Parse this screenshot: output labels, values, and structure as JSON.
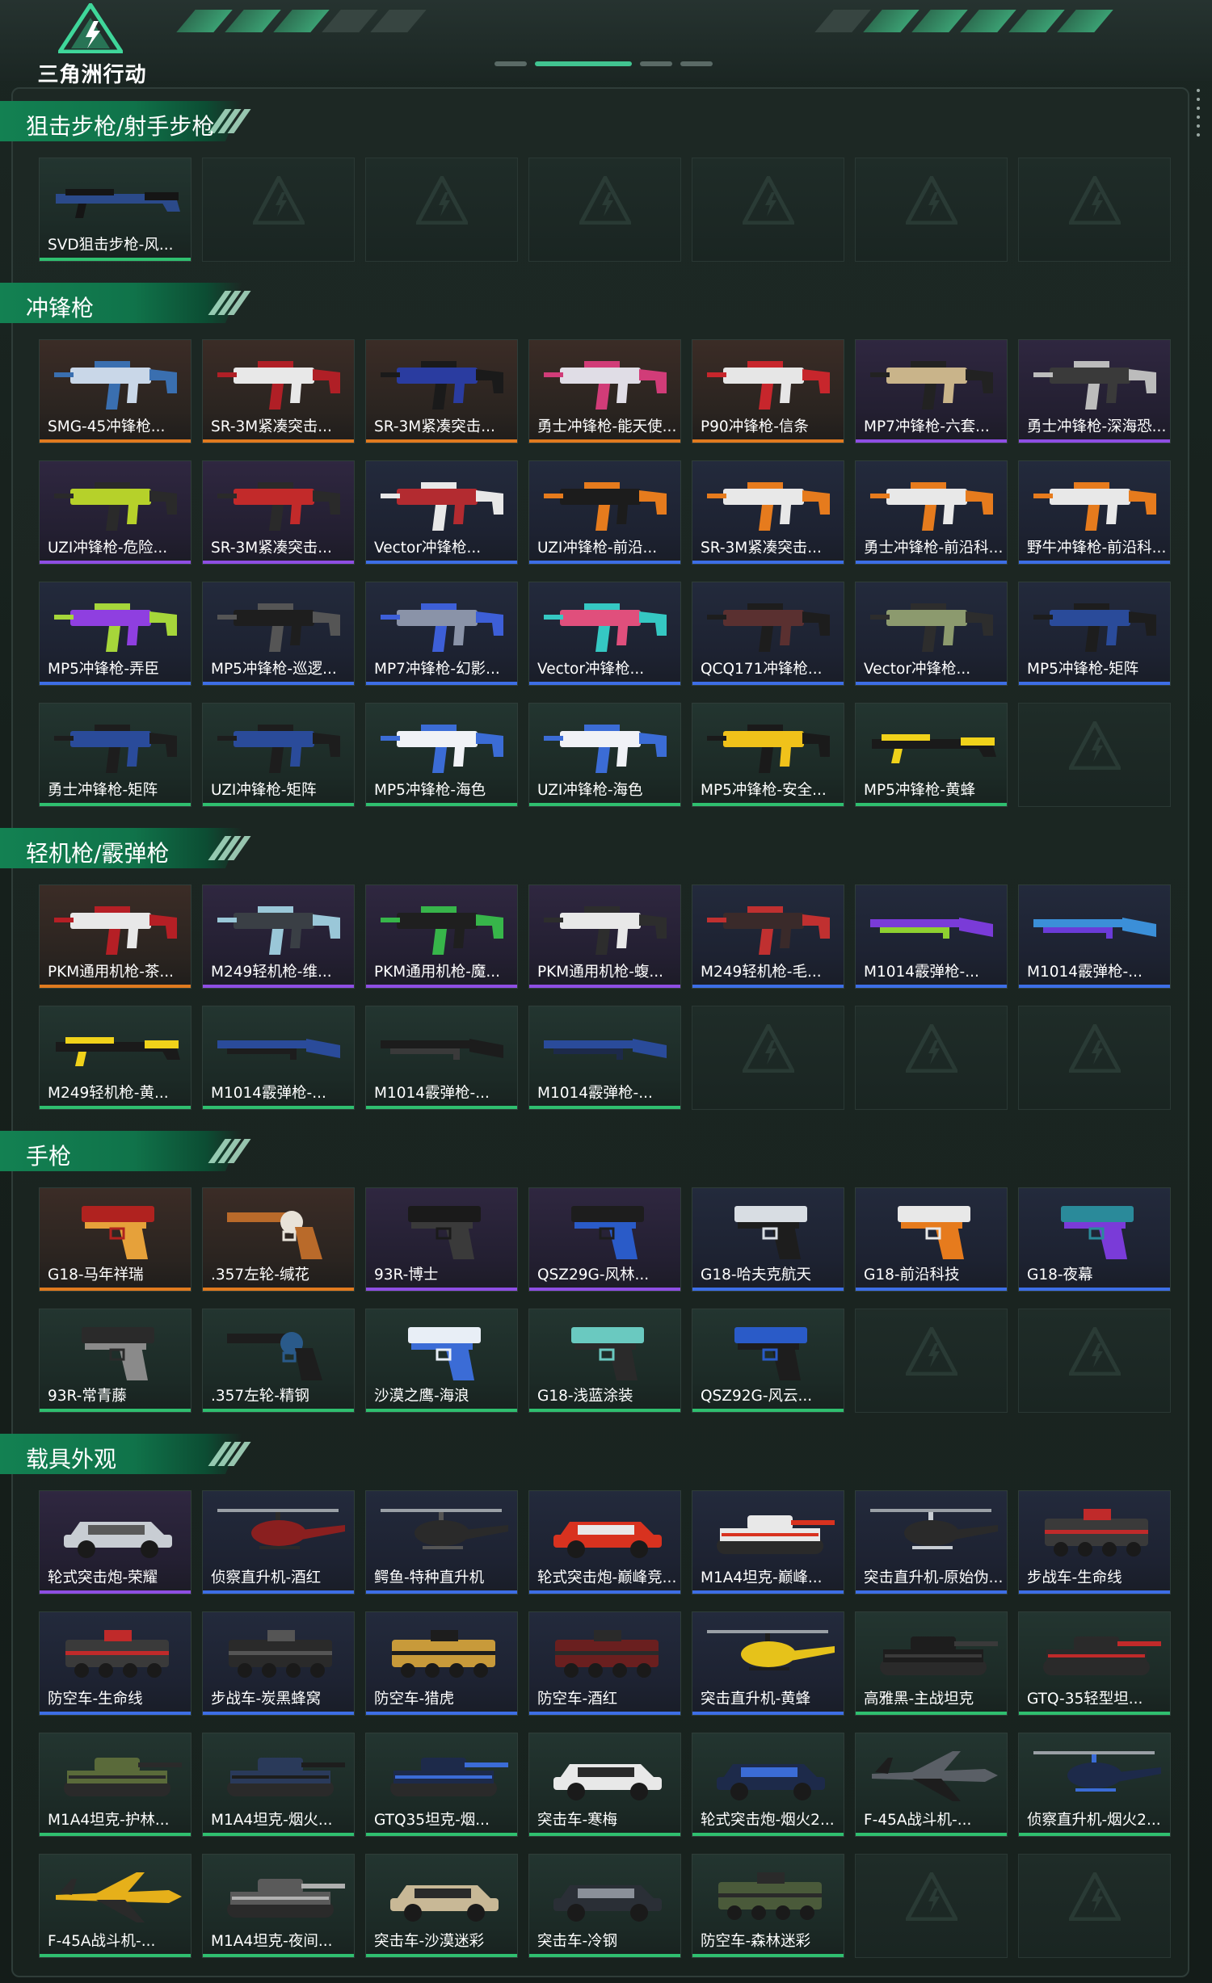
{
  "header": {
    "logo_text": "三角洲行动",
    "accent_color": "#3fb37f"
  },
  "sections": [
    {
      "title": "狙击步枪/射手步枪",
      "items": [
        {
          "name": "SVD狙击步枪-风...",
          "tier": "green",
          "type": "rifle",
          "c1": "#2b4a8a",
          "c2": "#151515"
        }
      ]
    },
    {
      "title": "冲锋枪",
      "items": [
        {
          "name": "SMG-45冲锋枪...",
          "tier": "gold",
          "type": "smg",
          "c1": "#c9d7e8",
          "c2": "#3a6fb0"
        },
        {
          "name": "SR-3M紧凑突击...",
          "tier": "gold",
          "type": "smg",
          "c1": "#e8e8e8",
          "c2": "#b01f26"
        },
        {
          "name": "SR-3M紧凑突击...",
          "tier": "gold",
          "type": "smg",
          "c1": "#2a3ca0",
          "c2": "#1a1a1a"
        },
        {
          "name": "勇士冲锋枪-能天使...",
          "tier": "gold",
          "type": "smg",
          "c1": "#e0dde6",
          "c2": "#d13c78"
        },
        {
          "name": "P90冲锋枪-信条",
          "tier": "gold",
          "type": "smg",
          "c1": "#e6e6e6",
          "c2": "#c7262c"
        },
        {
          "name": "MP7冲锋枪-六套...",
          "tier": "purple",
          "type": "smg",
          "c1": "#c9b48a",
          "c2": "#222222"
        },
        {
          "name": "勇士冲锋枪-深海恐...",
          "tier": "purple",
          "type": "smg",
          "c1": "#3a3a3a",
          "c2": "#bcbcbc"
        },
        {
          "name": "UZI冲锋枪-危险...",
          "tier": "purple",
          "type": "smg",
          "c1": "#b6d12a",
          "c2": "#2a2a2a"
        },
        {
          "name": "SR-3M紧凑突击...",
          "tier": "purple",
          "type": "smg",
          "c1": "#c22a2a",
          "c2": "#2a2a2a"
        },
        {
          "name": "Vector冲锋枪...",
          "tier": "blue",
          "type": "smg",
          "c1": "#b32b30",
          "c2": "#e8e8e8"
        },
        {
          "name": "UZI冲锋枪-前沿...",
          "tier": "blue",
          "type": "smg",
          "c1": "#1c1c1c",
          "c2": "#e67b1d"
        },
        {
          "name": "SR-3M紧凑突击...",
          "tier": "blue",
          "type": "smg",
          "c1": "#e8e8e8",
          "c2": "#e67b1d"
        },
        {
          "name": "勇士冲锋枪-前沿科...",
          "tier": "blue",
          "type": "smg",
          "c1": "#e8e8e8",
          "c2": "#e67b1d"
        },
        {
          "name": "野牛冲锋枪-前沿科...",
          "tier": "blue",
          "type": "smg",
          "c1": "#e8e8e8",
          "c2": "#e67b1d"
        },
        {
          "name": "MP5冲锋枪-弄臣",
          "tier": "blue",
          "type": "smg",
          "c1": "#8f3fe0",
          "c2": "#a6d63a"
        },
        {
          "name": "MP5冲锋枪-巡逻...",
          "tier": "blue",
          "type": "smg",
          "c1": "#1e1e1e",
          "c2": "#555555"
        },
        {
          "name": "MP7冲锋枪-幻影...",
          "tier": "blue",
          "type": "smg",
          "c1": "#8a93a8",
          "c2": "#3d5fd8"
        },
        {
          "name": "Vector冲锋枪...",
          "tier": "blue",
          "type": "smg",
          "c1": "#e04f7c",
          "c2": "#35c8c3"
        },
        {
          "name": "QCQ171冲锋枪...",
          "tier": "blue",
          "type": "smg",
          "c1": "#5a3030",
          "c2": "#1d1d1d"
        },
        {
          "name": "Vector冲锋枪...",
          "tier": "blue",
          "type": "smg",
          "c1": "#8c9a6e",
          "c2": "#2d2d2d"
        },
        {
          "name": "MP5冲锋枪-矩阵",
          "tier": "blue",
          "type": "smg",
          "c1": "#2a4b9a",
          "c2": "#1d1d1d"
        },
        {
          "name": "勇士冲锋枪-矩阵",
          "tier": "green",
          "type": "smg",
          "c1": "#2a4b9a",
          "c2": "#1d1d1d"
        },
        {
          "name": "UZI冲锋枪-矩阵",
          "tier": "green",
          "type": "smg",
          "c1": "#2a4b9a",
          "c2": "#1d1d1d"
        },
        {
          "name": "MP5冲锋枪-海色",
          "tier": "green",
          "type": "smg",
          "c1": "#f0f2f6",
          "c2": "#3b6cd6"
        },
        {
          "name": "UZI冲锋枪-海色",
          "tier": "green",
          "type": "smg",
          "c1": "#f0f2f6",
          "c2": "#3b6cd6"
        },
        {
          "name": "MP5冲锋枪-安全...",
          "tier": "green",
          "type": "smg",
          "c1": "#f0c21a",
          "c2": "#1a1a1a"
        },
        {
          "name": "MP5冲锋枪-黄蜂",
          "tier": "green",
          "type": "rifle",
          "c1": "#1a1a1a",
          "c2": "#f0d21a"
        }
      ]
    },
    {
      "title": "轻机枪/霰弹枪",
      "items": [
        {
          "name": "PKM通用机枪-茶...",
          "tier": "gold",
          "type": "smg",
          "c1": "#e8e8e8",
          "c2": "#b51f25"
        },
        {
          "name": "M249轻机枪-维...",
          "tier": "purple",
          "type": "smg",
          "c1": "#3a3f45",
          "c2": "#9ac7d8"
        },
        {
          "name": "PKM通用机枪-魔...",
          "tier": "purple",
          "type": "smg",
          "c1": "#1f1f1f",
          "c2": "#37b54a"
        },
        {
          "name": "PKM通用机枪-蝮...",
          "tier": "purple",
          "type": "smg",
          "c1": "#e8e8e8",
          "c2": "#2d2d2d"
        },
        {
          "name": "M249轻机枪-毛...",
          "tier": "blue",
          "type": "smg",
          "c1": "#3a2a2a",
          "c2": "#c03030"
        },
        {
          "name": "M1014霰弹枪-...",
          "tier": "blue",
          "type": "shotgun",
          "c1": "#7a3bd8",
          "c2": "#8ed030"
        },
        {
          "name": "M1014霰弹枪-...",
          "tier": "blue",
          "type": "shotgun",
          "c1": "#3b8fd8",
          "c2": "#6a3bd8"
        },
        {
          "name": "M249轻机枪-黄...",
          "tier": "green",
          "type": "rifle",
          "c1": "#1a1a1a",
          "c2": "#f0d21a"
        },
        {
          "name": "M1014霰弹枪-...",
          "tier": "green",
          "type": "shotgun",
          "c1": "#2a4b9a",
          "c2": "#1d1d1d"
        },
        {
          "name": "M1014霰弹枪-...",
          "tier": "green",
          "type": "shotgun",
          "c1": "#1c1c1c",
          "c2": "#3a3a3a"
        },
        {
          "name": "M1014霰弹枪-...",
          "tier": "green",
          "type": "shotgun",
          "c1": "#2a4b9a",
          "c2": "#1d2a4a"
        }
      ]
    },
    {
      "title": "手枪",
      "items": [
        {
          "name": "G18-马年祥瑞",
          "tier": "gold",
          "type": "pistol",
          "c1": "#b0221f",
          "c2": "#e6a13a"
        },
        {
          "name": ".357左轮-缄花",
          "tier": "gold",
          "type": "revolver",
          "c1": "#e8e2d8",
          "c2": "#b96a2a"
        },
        {
          "name": "93R-博士",
          "tier": "purple",
          "type": "pistol",
          "c1": "#1a1a1a",
          "c2": "#3a3a3a"
        },
        {
          "name": "QSZ29G-风林...",
          "tier": "purple",
          "type": "pistol",
          "c1": "#1d1d1d",
          "c2": "#2a5bc8"
        },
        {
          "name": "G18-哈夫克航天",
          "tier": "blue",
          "type": "pistol",
          "c1": "#d8dde3",
          "c2": "#1d1d1d"
        },
        {
          "name": "G18-前沿科技",
          "tier": "blue",
          "type": "pistol",
          "c1": "#e8e8e8",
          "c2": "#e67b1d"
        },
        {
          "name": "G18-夜幕",
          "tier": "blue",
          "type": "pistol",
          "c1": "#2a8a9a",
          "c2": "#7a3bd8"
        },
        {
          "name": "93R-常青藤",
          "tier": "green",
          "type": "pistol",
          "c1": "#2a2a2a",
          "c2": "#8a8a8a"
        },
        {
          "name": ".357左轮-精钢",
          "tier": "green",
          "type": "revolver",
          "c1": "#2a5a8a",
          "c2": "#1d1d1d"
        },
        {
          "name": "沙漠之鹰-海浪",
          "tier": "green",
          "type": "pistol",
          "c1": "#e8eef6",
          "c2": "#3b6cd6"
        },
        {
          "name": "G18-浅蓝涂装",
          "tier": "green",
          "type": "pistol",
          "c1": "#6ac9c0",
          "c2": "#2a2a2a"
        },
        {
          "name": "QSZ92G-风云...",
          "tier": "green",
          "type": "pistol",
          "c1": "#2a5bc8",
          "c2": "#1d1d1d"
        }
      ]
    },
    {
      "title": "载具外观",
      "items": [
        {
          "name": "轮式突击炮-荣耀",
          "tier": "purple",
          "type": "car",
          "c1": "#c8cdd3",
          "c2": "#5a5a5a"
        },
        {
          "name": "侦察直升机-酒红",
          "tier": "blue",
          "type": "heli",
          "c1": "#8a1f1f",
          "c2": "#2a2a2a"
        },
        {
          "name": "鳄鱼-特种直升机",
          "tier": "blue",
          "type": "heli",
          "c1": "#2a2a2a",
          "c2": "#555555"
        },
        {
          "name": "轮式突击炮-巅峰竞...",
          "tier": "blue",
          "type": "car",
          "c1": "#d8321f",
          "c2": "#e8e8e8"
        },
        {
          "name": "M1A4坦克-巅峰...",
          "tier": "blue",
          "type": "tank",
          "c1": "#e8e8e8",
          "c2": "#d8321f"
        },
        {
          "name": "突击直升机-原始伪...",
          "tier": "blue",
          "type": "heli",
          "c1": "#2a2a2a",
          "c2": "#c8cdd3"
        },
        {
          "name": "步战车-生命线",
          "tier": "blue",
          "type": "apc",
          "c1": "#3a3a3a",
          "c2": "#c02a2a"
        },
        {
          "name": "防空车-生命线",
          "tier": "blue",
          "type": "apc",
          "c1": "#3a3a3a",
          "c2": "#c02a2a"
        },
        {
          "name": "步战车-炭黑蜂窝",
          "tier": "blue",
          "type": "apc",
          "c1": "#2a2a2a",
          "c2": "#555555"
        },
        {
          "name": "防空车-猎虎",
          "tier": "blue",
          "type": "apc",
          "c1": "#c89a3a",
          "c2": "#1d1d1d"
        },
        {
          "name": "防空车-酒红",
          "tier": "blue",
          "type": "apc",
          "c1": "#6a1f1f",
          "c2": "#2a2a2a"
        },
        {
          "name": "突击直升机-黄蜂",
          "tier": "blue",
          "type": "heli",
          "c1": "#e6c21a",
          "c2": "#1d1d1d"
        },
        {
          "name": "高雅黑-主战坦克",
          "tier": "green",
          "type": "tank",
          "c1": "#1d1d1d",
          "c2": "#3a3a3a"
        },
        {
          "name": "GTQ-35轻型坦...",
          "tier": "green",
          "type": "tank",
          "c1": "#2a2a2a",
          "c2": "#c02a2a"
        },
        {
          "name": "M1A4坦克-护林...",
          "tier": "green",
          "type": "tank",
          "c1": "#5a6a3a",
          "c2": "#2a2a2a"
        },
        {
          "name": "M1A4坦克-烟火...",
          "tier": "green",
          "type": "tank",
          "c1": "#2a3a5a",
          "c2": "#1d1d1d"
        },
        {
          "name": "GTQ35坦克-烟...",
          "tier": "green",
          "type": "tank",
          "c1": "#1d2a4a",
          "c2": "#3b6cd6"
        },
        {
          "name": "突击车-寒梅",
          "tier": "green",
          "type": "car",
          "c1": "#e8e8e8",
          "c2": "#2a2a2a"
        },
        {
          "name": "轮式突击炮-烟火2...",
          "tier": "green",
          "type": "car",
          "c1": "#1d2a4a",
          "c2": "#3b6cd6"
        },
        {
          "name": "F-45A战斗机-...",
          "tier": "green",
          "type": "jet",
          "c1": "#5a5f66",
          "c2": "#1d1d1d"
        },
        {
          "name": "侦察直升机-烟火2...",
          "tier": "green",
          "type": "heli",
          "c1": "#1d2a4a",
          "c2": "#3b6cd6"
        },
        {
          "name": "F-45A战斗机-...",
          "tier": "green",
          "type": "jet",
          "c1": "#e6b01a",
          "c2": "#2a2a2a"
        },
        {
          "name": "M1A4坦克-夜间...",
          "tier": "green",
          "type": "tank",
          "c1": "#5a5a5a",
          "c2": "#b0b0b0"
        },
        {
          "name": "突击车-沙漠迷彩",
          "tier": "green",
          "type": "car",
          "c1": "#c8b896",
          "c2": "#2a2a2a"
        },
        {
          "name": "突击车-冷钢",
          "tier": "green",
          "type": "car",
          "c1": "#2a2f36",
          "c2": "#8a9099"
        },
        {
          "name": "防空车-森林迷彩",
          "tier": "green",
          "type": "apc",
          "c1": "#4a5a3a",
          "c2": "#2a2a2a"
        }
      ]
    }
  ]
}
